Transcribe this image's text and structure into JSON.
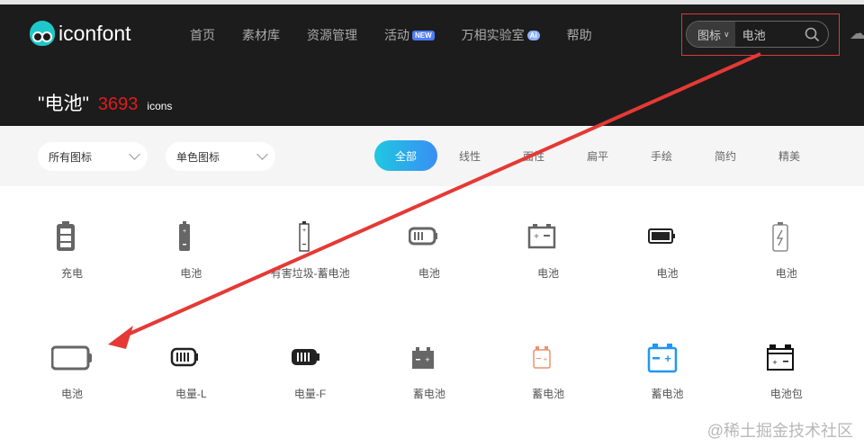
{
  "header": {
    "logo": "iconfont",
    "nav": [
      {
        "label": "首页"
      },
      {
        "label": "素材库"
      },
      {
        "label": "资源管理"
      },
      {
        "label": "活动",
        "badge": "NEW"
      },
      {
        "label": "万相实验室",
        "badge": "Ai"
      },
      {
        "label": "帮助"
      }
    ],
    "search": {
      "type": "图标",
      "value": "电池"
    }
  },
  "title": {
    "query": "\"电池\"",
    "count": "3693",
    "unit": "icons"
  },
  "filters": {
    "scope": "所有图标",
    "color": "单色图标",
    "tabs": [
      "全部",
      "线性",
      "面性",
      "扁平",
      "手绘",
      "简约",
      "精美"
    ],
    "active_tab": "全部"
  },
  "icons": [
    {
      "label": "充电",
      "color": "#666666"
    },
    {
      "label": "电池",
      "color": "#666666"
    },
    {
      "label": "有害垃圾-蓄电池",
      "color": "#333333"
    },
    {
      "label": "电池",
      "color": "#666666"
    },
    {
      "label": "电池",
      "color": "#666666"
    },
    {
      "label": "电池",
      "color": "#222222"
    },
    {
      "label": "电池",
      "color": "#777777"
    },
    {
      "label": "电池",
      "color": "#666666"
    },
    {
      "label": "电量-L",
      "color": "#222222"
    },
    {
      "label": "电量-F",
      "color": "#222222"
    },
    {
      "label": "蓄电池",
      "color": "#666666"
    },
    {
      "label": "蓄电池",
      "color": "#f0906a"
    },
    {
      "label": "蓄电池",
      "color": "#2196f3"
    },
    {
      "label": "电池包",
      "color": "#111111"
    }
  ],
  "watermark": "@稀土掘金技术社区",
  "annotation_color": "#e53935"
}
